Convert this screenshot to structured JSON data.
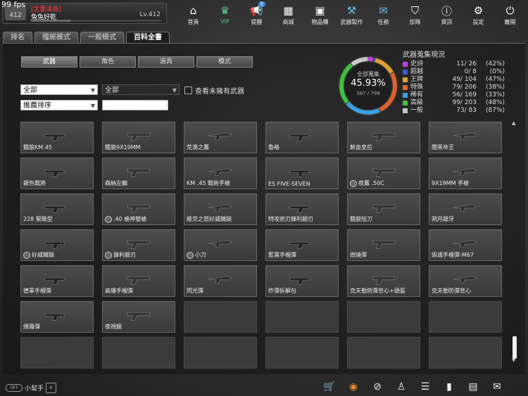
{
  "fps": "99 fps",
  "profile": {
    "level_badge": "412",
    "title": "[主要演員]",
    "name": "兔兔好乾",
    "level": "Lv.412",
    "exp_fraction": 0.3
  },
  "nav": [
    {
      "label": "首頁",
      "icon": "home-icon"
    },
    {
      "label": "VIP",
      "icon": "crown-icon"
    },
    {
      "label": "提醒",
      "icon": "megaphone-icon",
      "badge": "5"
    },
    {
      "label": "商城",
      "icon": "shop-icon"
    },
    {
      "label": "物品欄",
      "icon": "briefcase-icon"
    },
    {
      "label": "武器製作",
      "icon": "weapon-craft-icon"
    },
    {
      "label": "任務",
      "icon": "ticket-icon"
    },
    {
      "label": "部隊",
      "icon": "shield-icon"
    },
    {
      "label": "資訊",
      "icon": "info-icon"
    },
    {
      "label": "設定",
      "icon": "gear-icon"
    },
    {
      "label": "離開",
      "icon": "power-icon"
    }
  ],
  "main_tabs": [
    "排名",
    "殭屍模式",
    "一般模式",
    "百科全書"
  ],
  "sub_tabs": [
    "武器",
    "角色",
    "道具",
    "模式"
  ],
  "filters": {
    "category": "全部",
    "subcategory": "全部",
    "sort": "推薦排序",
    "search": ""
  },
  "checkbox_label": "查看未擁有武器",
  "collection": {
    "title": "全部蒐集",
    "percent": "45.93%",
    "count": "367 / 799",
    "heading": "武器蒐集現況",
    "rows": [
      {
        "name": "史詩",
        "value": "11/  26",
        "pct": "(42%)",
        "color": "#c040e0"
      },
      {
        "name": "超越",
        "value": "0/   8",
        "pct": "(0%)",
        "color": "#3a5ae0"
      },
      {
        "name": "王牌",
        "value": "49/ 104",
        "pct": "(47%)",
        "color": "#e0a030"
      },
      {
        "name": "特殊",
        "value": "79/ 206",
        "pct": "(38%)",
        "color": "#e06030"
      },
      {
        "name": "稀有",
        "value": "56/ 169",
        "pct": "(33%)",
        "color": "#3aa0e0"
      },
      {
        "name": "高級",
        "value": "99/ 203",
        "pct": "(48%)",
        "color": "#40c040"
      },
      {
        "name": "一般",
        "value": "73/  83",
        "pct": "(87%)",
        "color": "#c8c8c8"
      }
    ]
  },
  "items": [
    {
      "label": "餓狼KM.45",
      "mark": false
    },
    {
      "label": "餓狼9X19MM",
      "mark": false
    },
    {
      "label": "荒漠之鷹",
      "mark": false
    },
    {
      "label": "魯格",
      "mark": false
    },
    {
      "label": "鮮血皇后",
      "mark": false
    },
    {
      "label": "闇黑帝王",
      "mark": false
    },
    {
      "label": "銀色戰將",
      "mark": false
    },
    {
      "label": "森納左輪",
      "mark": false
    },
    {
      "label": "KM .45 戰術手槍",
      "mark": false
    },
    {
      "label": "ES FIVE-SEVEN",
      "mark": false
    },
    {
      "label": "夜鷹 .50C",
      "mark": true
    },
    {
      "label": "9X19MM 手槍",
      "mark": false
    },
    {
      "label": "228 緊緻型",
      "mark": false
    },
    {
      "label": ".40 槍神雙槍",
      "mark": true
    },
    {
      "label": "維京之怒好威鐵鎚",
      "mark": false
    },
    {
      "label": "特攻密刃鋒利銀刃",
      "mark": false
    },
    {
      "label": "餓狼短刀",
      "mark": false
    },
    {
      "label": "朔月銀牙",
      "mark": false
    },
    {
      "label": "好威鐵鎚",
      "mark": true
    },
    {
      "label": "鋒利銀刃",
      "mark": true
    },
    {
      "label": "小刀",
      "mark": true
    },
    {
      "label": "藍寶手榴彈",
      "mark": false
    },
    {
      "label": "燃燒彈",
      "mark": false
    },
    {
      "label": "毀滅手榴彈-M67",
      "mark": false
    },
    {
      "label": "德軍手榴彈",
      "mark": false
    },
    {
      "label": "高爆手榴彈",
      "mark": false
    },
    {
      "label": "閃光彈",
      "mark": false
    },
    {
      "label": "炸彈拆解包",
      "mark": false
    },
    {
      "label": "克夫勒防彈背心+頭盔",
      "mark": false
    },
    {
      "label": "克夫勒防彈背心",
      "mark": false
    },
    {
      "label": "煙霧彈",
      "mark": false
    },
    {
      "label": "夜視鏡",
      "mark": false
    },
    {
      "label": "",
      "mark": false
    },
    {
      "label": "",
      "mark": false
    },
    {
      "label": "",
      "mark": false
    },
    {
      "label": "",
      "mark": false
    },
    {
      "label": "",
      "mark": false
    },
    {
      "label": "",
      "mark": false
    },
    {
      "label": "",
      "mark": false
    },
    {
      "label": "",
      "mark": false
    },
    {
      "label": "",
      "mark": false
    },
    {
      "label": "",
      "mark": false
    }
  ],
  "helper": {
    "toggle": "OFF",
    "label": "小幫手"
  },
  "bottom_icons": [
    "cart-icon",
    "coin-icon",
    "compass-icon",
    "runner-icon",
    "checklist-icon",
    "book-icon",
    "calendar-icon",
    "mail-icon"
  ]
}
